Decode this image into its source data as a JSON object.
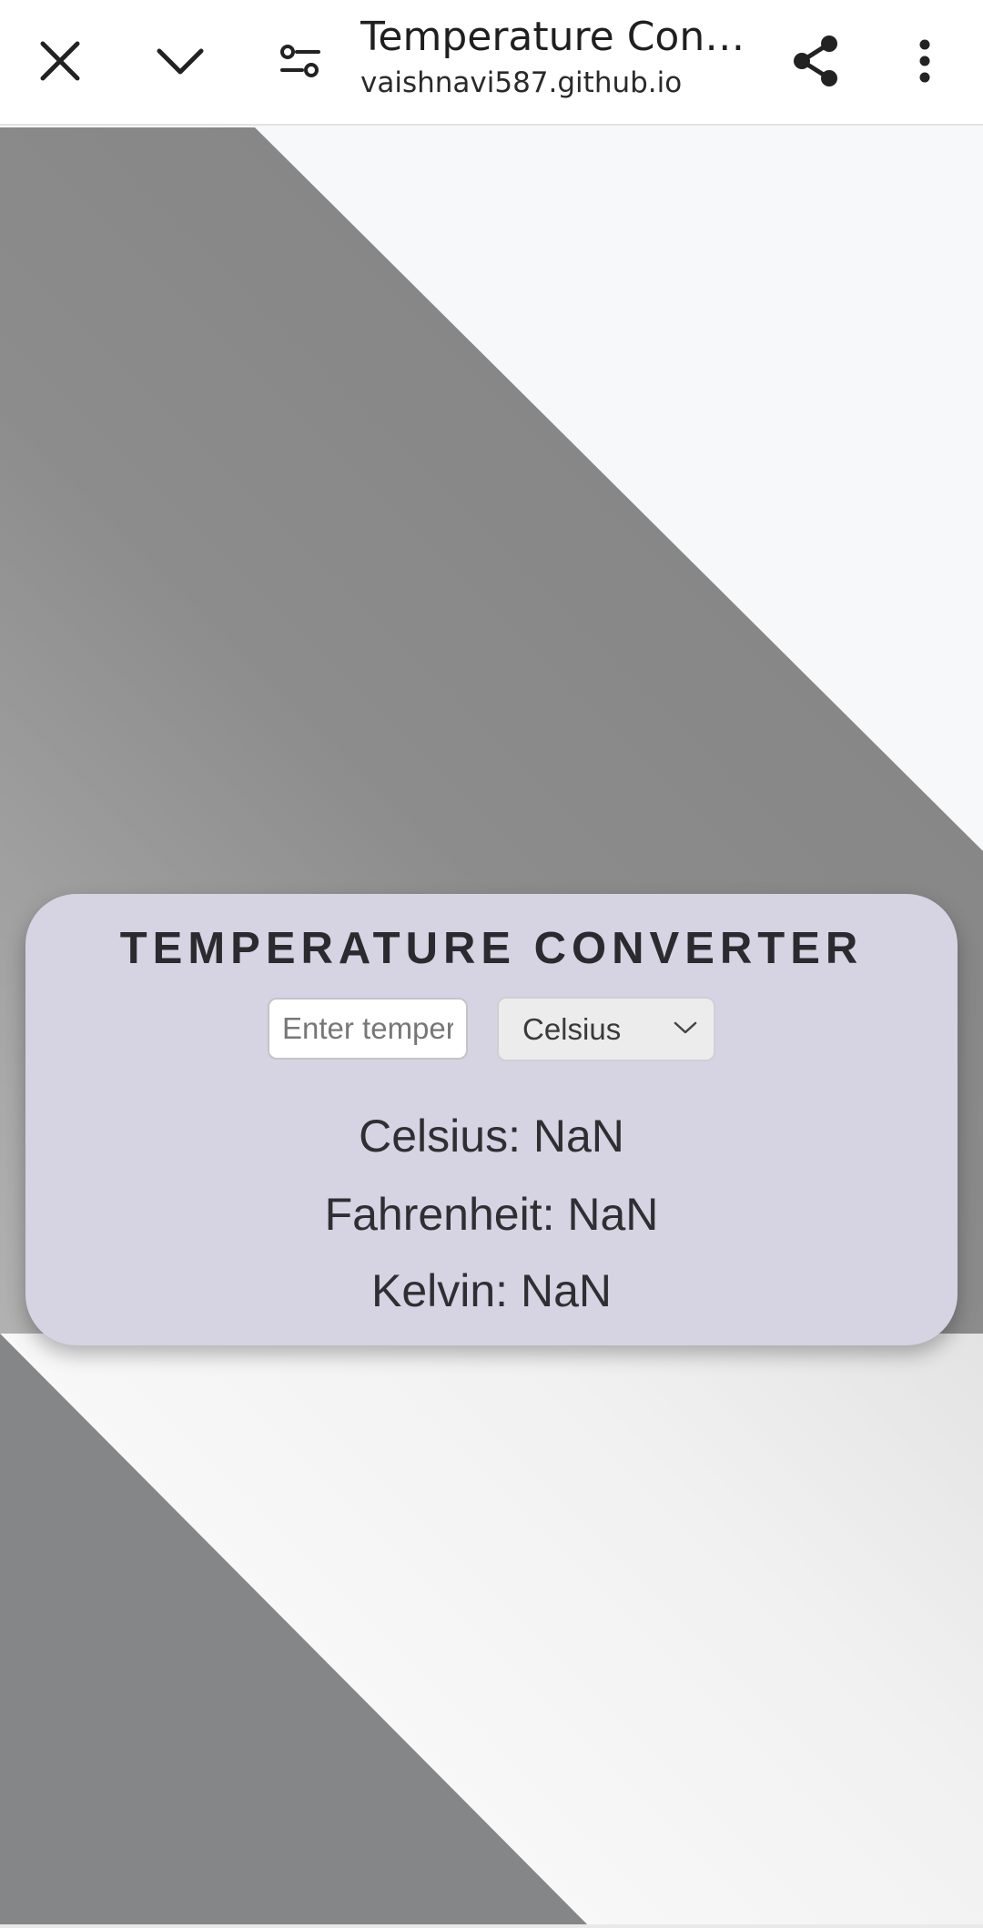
{
  "browser": {
    "title": "Temperature Conv...",
    "url": "vaishnavi587.github.io",
    "icons": {
      "close": "close-icon",
      "minimize": "chevron-down-icon",
      "site_settings": "tune-icon",
      "share": "share-icon",
      "more": "more-vert-icon"
    }
  },
  "converter": {
    "heading": "TEMPERATURE CONVERTER",
    "input": {
      "value": "",
      "placeholder": "Enter temperature"
    },
    "unit_select": {
      "selected": "Celsius",
      "icon": "chevron-down-icon"
    },
    "results": {
      "celsius": "Celsius: NaN",
      "fahrenheit": "Fahrenheit: NaN",
      "kelvin": "Kelvin: NaN"
    }
  },
  "colors": {
    "card_background": "#d6d3e2",
    "heading_text": "#2a2a2f",
    "page_background": "#f7f8fa",
    "diagonal_band": "#8c8c8c"
  }
}
